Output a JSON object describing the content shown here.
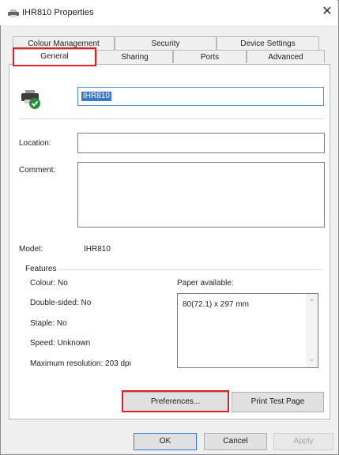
{
  "window": {
    "title": "IHR810 Properties",
    "close_icon": "close-icon"
  },
  "tabs": {
    "row1": [
      "Colour Management",
      "Security",
      "Device Settings"
    ],
    "row2": [
      "General",
      "Sharing",
      "Ports",
      "Advanced"
    ],
    "active": "General"
  },
  "general": {
    "printer_name": "IHR810",
    "location_label": "Location:",
    "location_value": "",
    "comment_label": "Comment:",
    "comment_value": "",
    "model_label": "Model:",
    "model_value": "IHR810"
  },
  "features": {
    "title": "Features",
    "colour": "Colour: No",
    "double_sided": "Double-sided: No",
    "staple": "Staple: No",
    "speed": "Speed: Unknown",
    "max_resolution": "Maximum resolution: 203 dpi",
    "paper_label": "Paper available:",
    "paper_items": [
      "80(72.1) x 297 mm"
    ]
  },
  "buttons": {
    "preferences": "Preferences...",
    "print_test_page": "Print Test Page",
    "ok": "OK",
    "cancel": "Cancel",
    "apply": "Apply"
  },
  "colors": {
    "highlight": "#e0202b",
    "selection": "#3b78c6",
    "focus_border": "#4a90d9"
  }
}
